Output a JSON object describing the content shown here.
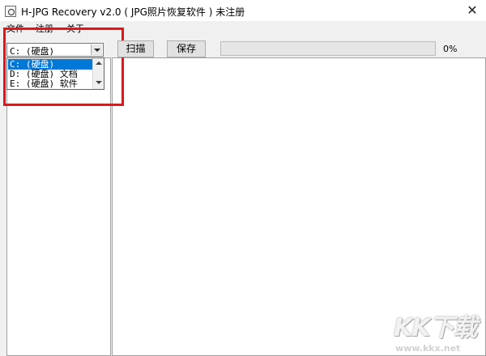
{
  "window": {
    "title": "H-JPG Recovery v2.0 ( JPG照片恢复软件 ) 未注册",
    "close_glyph": "✕"
  },
  "menu": {
    "items": [
      "文件",
      "注册",
      "关于"
    ]
  },
  "drive_select": {
    "value": "C: (硬盘)",
    "options": [
      "C: (硬盘)",
      "D: (硬盘) 文档",
      "E: (硬盘) 软件"
    ],
    "selected_index": 0
  },
  "toolbar": {
    "scan_label": "扫描",
    "save_label": "保存"
  },
  "progress": {
    "percent_text": "0%",
    "value": 0
  },
  "watermark": {
    "text": "KK下载",
    "url": "www.kkx.net"
  },
  "colors": {
    "selection": "#0078d7",
    "annotation": "#d7191c",
    "window_bg": "#f0f0f0"
  }
}
